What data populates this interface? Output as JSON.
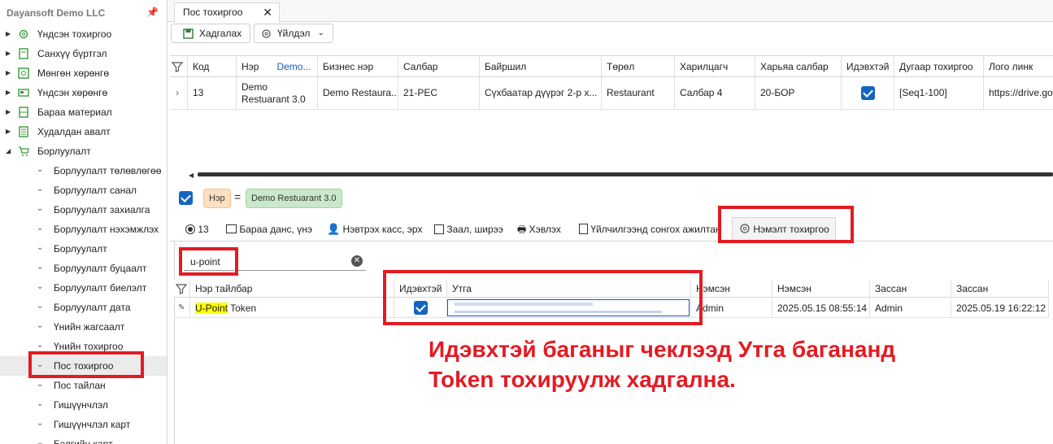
{
  "sidebar": {
    "company": "Dayansoft Demo LLC",
    "top_items": [
      {
        "label": "Үндсэн тохиргоо",
        "icon": "gear-icon"
      },
      {
        "label": "Санхүү бүртгэл",
        "icon": "ledger-icon"
      },
      {
        "label": "Мөнгөн хөрөнгө",
        "icon": "money-icon"
      },
      {
        "label": "Үндсэн хөрөнгө",
        "icon": "asset-icon"
      },
      {
        "label": "Бараа материал",
        "icon": "inventory-icon"
      },
      {
        "label": "Худалдан авалт",
        "icon": "purchase-icon"
      },
      {
        "label": "Борлуулалт",
        "icon": "cart-icon"
      }
    ],
    "sub_items": [
      "Борлуулалт төлөвлөгөө",
      "Борлуулалт санал",
      "Борлуулалт захиалга",
      "Борлуулалт нэхэмжлэх",
      "Борлуулалт",
      "Борлуулалт буцаалт",
      "Борлуулалт биелэлт",
      "Борлуулалт дата",
      "Үнийн жагсаалт",
      "Үнийн тохиргоо",
      "Пос тохиргоо",
      "Пос тайлан",
      "Гишүүнчлэл",
      "Гишүүнчлэл карт",
      "Бэлгийн карт"
    ]
  },
  "tab": {
    "title": "Пос тохиргоо",
    "close": "✕"
  },
  "toolbar": {
    "save": "Хадгалах",
    "action": "Үйлдэл"
  },
  "grid": {
    "headers": [
      "Код",
      "Нэр",
      "Demo...",
      "Бизнес нэр",
      "Салбар",
      "Байршил",
      "Төрөл",
      "Харилцагч",
      "Харьяа салбар",
      "Идэвхтэй",
      "Дугаар тохиргоо",
      "Лого линк"
    ],
    "row": {
      "code": "13",
      "name": "Demo Restuarant 3.0",
      "business": "Demo Restaura...",
      "branch": "21-PEC",
      "location": "Сүхбаатар дүүрэг 2-р х...",
      "type": "Restaurant",
      "partner": "Салбар 4",
      "parent_branch": "20-БОР",
      "active": true,
      "number_setting": "[Seq1-100]",
      "logo": "https://drive.goo"
    }
  },
  "filter": {
    "field": "Нэр",
    "op": "=",
    "value": "Demo Restuarant 3.0"
  },
  "subtabs": [
    "13",
    "Бараа данс, үнэ",
    "Нэвтрэх касс, эрх",
    "Заал, ширээ",
    "Хэвлэх",
    "Үйлчилгээнд сонгох ажилтан",
    "Нэмэлт тохиргоо"
  ],
  "search": {
    "value": "u-point"
  },
  "bottom_grid": {
    "headers": [
      "Нэр тайлбар",
      "Идэвхтэй",
      "Утга",
      "Нэмсэн",
      "Нэмсэн",
      "Зассан",
      "Зассан"
    ],
    "row": {
      "name_highlight": "U-Point",
      "name_rest": " Token",
      "active": true,
      "value": "",
      "added_by": "Admin",
      "added_at": "2025.05.15 08:55:14",
      "edited_by": "Admin",
      "edited_at": "2025.05.19 16:22:12"
    }
  },
  "annotation": {
    "line1": "Идэвхтэй баганыг чеклээд Утга багананд",
    "line2": "Token тохируулж хадгална."
  },
  "colors": {
    "annotation_red": "#e31b23",
    "checkbox_blue": "#1565c0",
    "chip_orange": "#fde0c4",
    "chip_green": "#c9e8c9",
    "highlight_yellow": "#ffff00"
  }
}
